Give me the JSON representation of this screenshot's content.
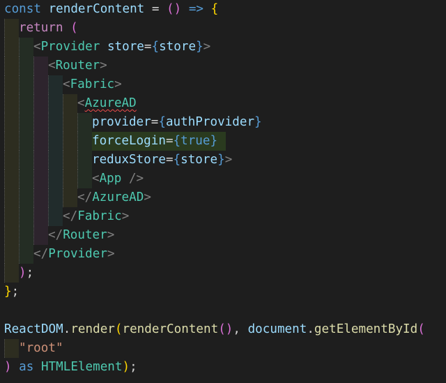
{
  "editor": {
    "colors": {
      "background": "#1e1e1e",
      "keyword": "#569cd6",
      "control": "#c586c0",
      "variable": "#9cdcfe",
      "function": "#dcdcaa",
      "tag": "#4ec9b0",
      "punct": "#d4d4d4",
      "bracket1": "#ffd700",
      "bracket2": "#da70d6",
      "bracket3": "#179fff",
      "string": "#ce9178",
      "bracket_tag": "#808080"
    },
    "lines": [
      {
        "indent": 0,
        "tokens": [
          {
            "t": "const",
            "c": "keyword"
          },
          {
            "t": " "
          },
          {
            "t": "renderContent",
            "c": "variable"
          },
          {
            "t": " = ",
            "c": "punct"
          },
          {
            "t": "()",
            "c": "bracket2"
          },
          {
            "t": " => ",
            "c": "keyword"
          },
          {
            "t": "{",
            "c": "bracket1"
          }
        ]
      },
      {
        "indent": 1,
        "tokens": [
          {
            "t": "return",
            "c": "control"
          },
          {
            "t": " "
          },
          {
            "t": "(",
            "c": "bracket2"
          }
        ]
      },
      {
        "indent": 2,
        "tokens": [
          {
            "t": "<",
            "c": "bracket_tag"
          },
          {
            "t": "Provider",
            "c": "tag"
          },
          {
            "t": " "
          },
          {
            "t": "store",
            "c": "variable"
          },
          {
            "t": "=",
            "c": "punct"
          },
          {
            "t": "{",
            "c": "keyword"
          },
          {
            "t": "store",
            "c": "variable"
          },
          {
            "t": "}",
            "c": "keyword"
          },
          {
            "t": ">",
            "c": "bracket_tag"
          }
        ]
      },
      {
        "indent": 3,
        "tokens": [
          {
            "t": "<",
            "c": "bracket_tag"
          },
          {
            "t": "Router",
            "c": "tag"
          },
          {
            "t": ">",
            "c": "bracket_tag"
          }
        ]
      },
      {
        "indent": 4,
        "tokens": [
          {
            "t": "<",
            "c": "bracket_tag"
          },
          {
            "t": "Fabric",
            "c": "tag"
          },
          {
            "t": ">",
            "c": "bracket_tag"
          }
        ]
      },
      {
        "indent": 5,
        "tokens": [
          {
            "t": "<",
            "c": "bracket_tag"
          },
          {
            "t": "AzureAD",
            "c": "tag",
            "squiggle": true
          }
        ]
      },
      {
        "indent": 6,
        "tokens": [
          {
            "t": "provider",
            "c": "variable"
          },
          {
            "t": "=",
            "c": "punct"
          },
          {
            "t": "{",
            "c": "keyword"
          },
          {
            "t": "authProvider",
            "c": "variable"
          },
          {
            "t": "}",
            "c": "keyword"
          }
        ]
      },
      {
        "indent": 6,
        "highlight": true,
        "tokens": [
          {
            "t": "forceLogin",
            "c": "variable"
          },
          {
            "t": "=",
            "c": "punct"
          },
          {
            "t": "{",
            "c": "keyword"
          },
          {
            "t": "true",
            "c": "keyword"
          },
          {
            "t": "}",
            "c": "keyword"
          }
        ]
      },
      {
        "indent": 6,
        "tokens": [
          {
            "t": "reduxStore",
            "c": "variable"
          },
          {
            "t": "=",
            "c": "punct"
          },
          {
            "t": "{",
            "c": "keyword"
          },
          {
            "t": "store",
            "c": "variable"
          },
          {
            "t": "}",
            "c": "keyword"
          },
          {
            "t": ">",
            "c": "bracket_tag"
          }
        ]
      },
      {
        "indent": 6,
        "tokens": [
          {
            "t": "<",
            "c": "bracket_tag"
          },
          {
            "t": "App",
            "c": "tag"
          },
          {
            "t": " />",
            "c": "bracket_tag"
          }
        ]
      },
      {
        "indent": 5,
        "tokens": [
          {
            "t": "</",
            "c": "bracket_tag"
          },
          {
            "t": "AzureAD",
            "c": "tag"
          },
          {
            "t": ">",
            "c": "bracket_tag"
          }
        ]
      },
      {
        "indent": 4,
        "tokens": [
          {
            "t": "</",
            "c": "bracket_tag"
          },
          {
            "t": "Fabric",
            "c": "tag"
          },
          {
            "t": ">",
            "c": "bracket_tag"
          }
        ]
      },
      {
        "indent": 3,
        "tokens": [
          {
            "t": "</",
            "c": "bracket_tag"
          },
          {
            "t": "Router",
            "c": "tag"
          },
          {
            "t": ">",
            "c": "bracket_tag"
          }
        ]
      },
      {
        "indent": 2,
        "tokens": [
          {
            "t": "</",
            "c": "bracket_tag"
          },
          {
            "t": "Provider",
            "c": "tag"
          },
          {
            "t": ">",
            "c": "bracket_tag"
          }
        ]
      },
      {
        "indent": 1,
        "tokens": [
          {
            "t": ")",
            "c": "bracket2"
          },
          {
            "t": ";",
            "c": "punct"
          }
        ]
      },
      {
        "indent": 0,
        "tokens": [
          {
            "t": "}",
            "c": "bracket1"
          },
          {
            "t": ";",
            "c": "punct"
          }
        ]
      },
      {
        "indent": 0,
        "tokens": []
      },
      {
        "indent": 0,
        "tokens": [
          {
            "t": "ReactDOM",
            "c": "variable"
          },
          {
            "t": ".",
            "c": "punct"
          },
          {
            "t": "render",
            "c": "function"
          },
          {
            "t": "(",
            "c": "bracket1"
          },
          {
            "t": "renderContent",
            "c": "function"
          },
          {
            "t": "()",
            "c": "bracket2"
          },
          {
            "t": ", ",
            "c": "punct"
          },
          {
            "t": "document",
            "c": "variable"
          },
          {
            "t": ".",
            "c": "punct"
          },
          {
            "t": "getElementById",
            "c": "function"
          },
          {
            "t": "(",
            "c": "bracket2"
          }
        ]
      },
      {
        "indent": 1,
        "tokens": [
          {
            "t": "\"root\"",
            "c": "string"
          }
        ]
      },
      {
        "indent": 0,
        "tokens": [
          {
            "t": ")",
            "c": "bracket2"
          },
          {
            "t": " as ",
            "c": "keyword"
          },
          {
            "t": "HTMLElement",
            "c": "tag"
          },
          {
            "t": ")",
            "c": "bracket1"
          },
          {
            "t": ";",
            "c": "punct"
          }
        ]
      }
    ]
  }
}
